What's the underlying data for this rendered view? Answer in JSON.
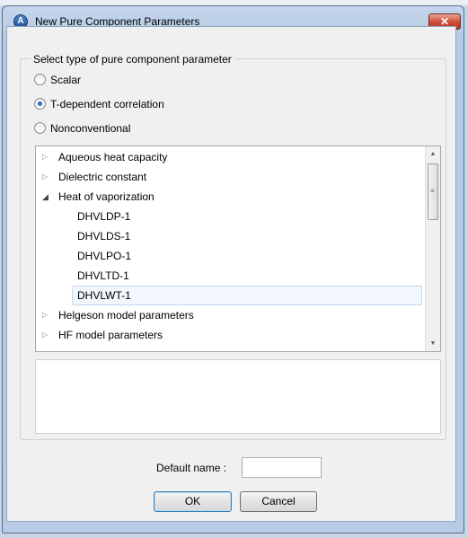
{
  "top_strip_text": "",
  "window": {
    "title": "New Pure Component Parameters",
    "close_symbol": "✕"
  },
  "group": {
    "legend": "Select type of pure component parameter",
    "options": [
      {
        "label": "Scalar",
        "checked": false
      },
      {
        "label": "T-dependent correlation",
        "checked": true
      },
      {
        "label": "Nonconventional",
        "checked": false
      }
    ]
  },
  "tree": {
    "rows": [
      {
        "label": "Aqueous heat capacity",
        "state": "collapsed"
      },
      {
        "label": "Dielectric constant",
        "state": "collapsed"
      },
      {
        "label": "Heat of vaporization",
        "state": "expanded"
      },
      {
        "label": "DHVLDP-1",
        "state": "leaf"
      },
      {
        "label": "DHVLDS-1",
        "state": "leaf"
      },
      {
        "label": "DHVLPO-1",
        "state": "leaf"
      },
      {
        "label": "DHVLTD-1",
        "state": "leaf"
      },
      {
        "label": "DHVLWT-1",
        "state": "leaf",
        "selected": true
      },
      {
        "label": "Helgeson model parameters",
        "state": "collapsed"
      },
      {
        "label": "HF model parameters",
        "state": "collapsed"
      }
    ]
  },
  "default_name": {
    "label": "Default name :",
    "value": ""
  },
  "buttons": {
    "ok": "OK",
    "cancel": "Cancel"
  }
}
